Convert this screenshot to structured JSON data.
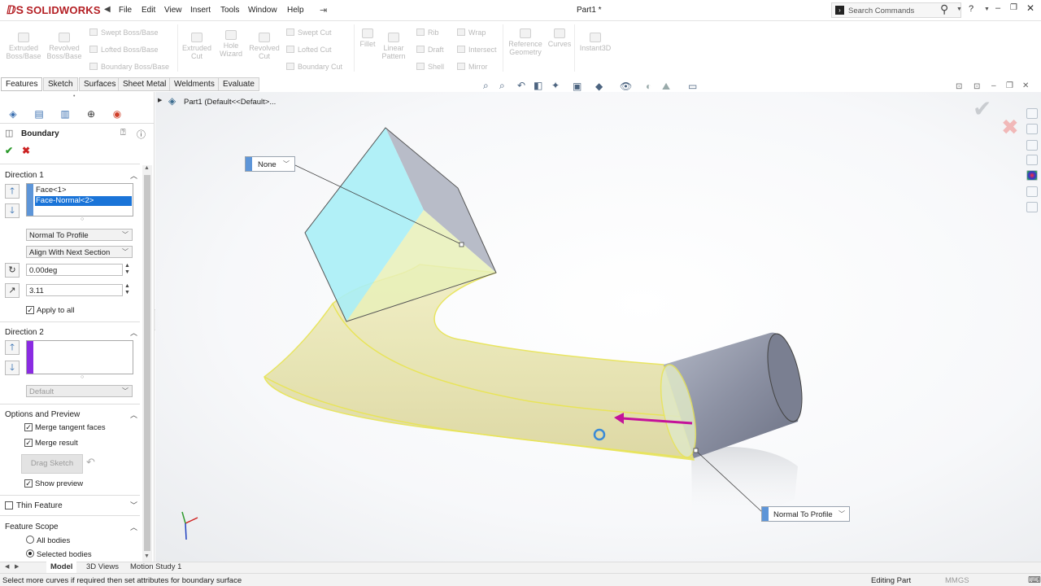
{
  "app": {
    "name": "SOLIDWORKS",
    "doc_title": "Part1 *"
  },
  "menu": [
    "File",
    "Edit",
    "View",
    "Insert",
    "Tools",
    "Window",
    "Help"
  ],
  "search": {
    "placeholder": "Search Commands"
  },
  "help_label": "?",
  "commands": {
    "extruded_boss": "Extruded Boss/Base",
    "revolved_boss": "Revolved Boss/Base",
    "swept_boss": "Swept Boss/Base",
    "lofted_boss": "Lofted Boss/Base",
    "boundary_boss": "Boundary Boss/Base",
    "extruded_cut": "Extruded Cut",
    "hole_wizard": "Hole Wizard",
    "revolved_cut": "Revolved Cut",
    "swept_cut": "Swept Cut",
    "lofted_cut": "Lofted Cut",
    "boundary_cut": "Boundary Cut",
    "fillet": "Fillet",
    "linear_pattern": "Linear Pattern",
    "rib": "Rib",
    "draft": "Draft",
    "shell": "Shell",
    "wrap": "Wrap",
    "intersect": "Intersect",
    "mirror": "Mirror",
    "reference_geometry": "Reference Geometry",
    "curves": "Curves",
    "instant3d": "Instant3D"
  },
  "tabs": [
    "Features",
    "Sketch",
    "Surfaces",
    "Sheet Metal",
    "Weldments",
    "Evaluate"
  ],
  "tree": {
    "item": "Part1  (Default<<Default>..."
  },
  "panel": {
    "title": "Boundary",
    "direction1": {
      "title": "Direction 1",
      "items": [
        "Face<1>",
        "Face-Normal<2>"
      ],
      "tangency": "Normal To Profile",
      "alignment": "Align With Next Section",
      "angle": "0.00deg",
      "length": "3.11",
      "apply_all": "Apply to all"
    },
    "direction2": {
      "title": "Direction 2",
      "tangency": "Default"
    },
    "options": {
      "title": "Options and Preview",
      "merge_tangent": "Merge tangent faces",
      "merge_result": "Merge result",
      "drag_sketch": "Drag Sketch",
      "show_preview": "Show preview"
    },
    "thin_feature": "Thin Feature",
    "feature_scope": {
      "title": "Feature Scope",
      "all_bodies": "All bodies",
      "selected_bodies": "Selected bodies"
    }
  },
  "callouts": {
    "top": "None",
    "bottom": "Normal To Profile"
  },
  "bottom_tabs": [
    "Model",
    "3D Views",
    "Motion Study 1"
  ],
  "status": {
    "message": "Select more curves if required then set attributes for boundary surface",
    "mode": "Editing Part",
    "units": "MMGS"
  },
  "colors": {
    "brand": "#b41f24",
    "accent": "#5d95d8",
    "selection": "#1a74d8",
    "surface": "#ece9a8",
    "arrow": "#c4129a"
  }
}
